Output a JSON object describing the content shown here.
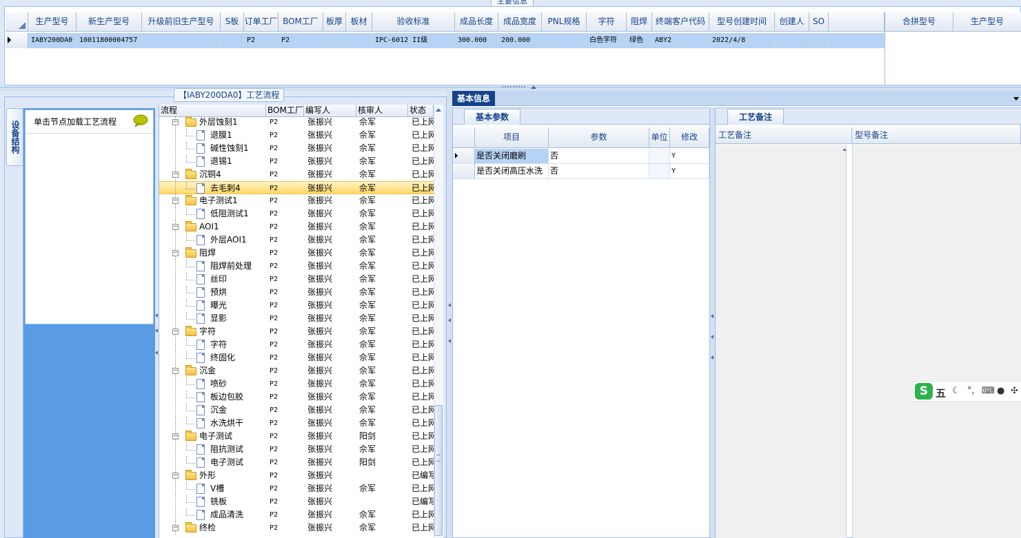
{
  "top": {
    "title": "主要信息",
    "columns": [
      "生产型号",
      "新生产型号",
      "升级前旧生产型号",
      "S板",
      "订单工厂",
      "BOM工厂",
      "板厚",
      "板材",
      "验收标准",
      "成品长度",
      "成品宽度",
      "PNL规格",
      "字符",
      "阻焊",
      "终端客户代码",
      "型号创建时间",
      "创建人",
      "SO"
    ],
    "row": [
      "IABY200DA0",
      "10011800004757",
      "",
      "",
      "P2",
      "P2",
      "",
      "",
      "IPC-6012 II级",
      "300.000",
      "200.000",
      "",
      "白色字符",
      "绿色",
      "ABY2",
      "2022/4/8",
      "",
      ""
    ],
    "merge_columns": [
      "合拼型号",
      "生产型号"
    ]
  },
  "process": {
    "title": "【IABY200DA0】工艺流程",
    "side_tab": "设备结构",
    "hint": "单击节点加载工艺流程",
    "columns": [
      "流程",
      "BOM工厂",
      "编写人",
      "核审人",
      "状态"
    ],
    "rows": [
      {
        "name": "外层蚀刻1",
        "type": "folder",
        "bom": "P2",
        "writer": "张振兴",
        "reviewer": "佘军",
        "status": "已上网"
      },
      {
        "name": "退膜1",
        "type": "leaf",
        "bom": "P2",
        "writer": "张振兴",
        "reviewer": "佘军",
        "status": "已上网"
      },
      {
        "name": "碱性蚀刻1",
        "type": "leaf",
        "bom": "P2",
        "writer": "张振兴",
        "reviewer": "佘军",
        "status": "已上网"
      },
      {
        "name": "退锡1",
        "type": "leaf",
        "bom": "P2",
        "writer": "张振兴",
        "reviewer": "佘军",
        "status": "已上网"
      },
      {
        "name": "沉铜4",
        "type": "folder",
        "bom": "P2",
        "writer": "张振兴",
        "reviewer": "佘军",
        "status": "已上网"
      },
      {
        "name": "去毛刺4",
        "type": "leaf",
        "bom": "P2",
        "writer": "张振兴",
        "reviewer": "佘军",
        "status": "已上网",
        "selected": true
      },
      {
        "name": "电子测试1",
        "type": "folder",
        "bom": "P2",
        "writer": "张振兴",
        "reviewer": "佘军",
        "status": "已上网"
      },
      {
        "name": "低阻测试1",
        "type": "leaf",
        "bom": "P2",
        "writer": "张振兴",
        "reviewer": "佘军",
        "status": "已上网"
      },
      {
        "name": "AOI1",
        "type": "folder",
        "bom": "P2",
        "writer": "张振兴",
        "reviewer": "佘军",
        "status": "已上网"
      },
      {
        "name": "外层AOI1",
        "type": "leaf",
        "bom": "P2",
        "writer": "张振兴",
        "reviewer": "佘军",
        "status": "已上网"
      },
      {
        "name": "阻焊",
        "type": "folder",
        "bom": "P2",
        "writer": "张振兴",
        "reviewer": "佘军",
        "status": "已上网"
      },
      {
        "name": "阻焊前处理",
        "type": "leaf",
        "bom": "P2",
        "writer": "张振兴",
        "reviewer": "佘军",
        "status": "已上网"
      },
      {
        "name": "丝印",
        "type": "leaf",
        "bom": "P2",
        "writer": "张振兴",
        "reviewer": "佘军",
        "status": "已上网"
      },
      {
        "name": "预烘",
        "type": "leaf",
        "bom": "P2",
        "writer": "张振兴",
        "reviewer": "佘军",
        "status": "已上网"
      },
      {
        "name": "曝光",
        "type": "leaf",
        "bom": "P2",
        "writer": "张振兴",
        "reviewer": "佘军",
        "status": "已上网"
      },
      {
        "name": "显影",
        "type": "leaf",
        "bom": "P2",
        "writer": "张振兴",
        "reviewer": "佘军",
        "status": "已上网"
      },
      {
        "name": "字符",
        "type": "folder",
        "bom": "P2",
        "writer": "张振兴",
        "reviewer": "佘军",
        "status": "已上网"
      },
      {
        "name": "字符",
        "type": "leaf",
        "bom": "P2",
        "writer": "张振兴",
        "reviewer": "佘军",
        "status": "已上网"
      },
      {
        "name": "终固化",
        "type": "leaf",
        "bom": "P2",
        "writer": "张振兴",
        "reviewer": "佘军",
        "status": "已上网"
      },
      {
        "name": "沉金",
        "type": "folder",
        "bom": "P2",
        "writer": "张振兴",
        "reviewer": "佘军",
        "status": "已上网"
      },
      {
        "name": "喷砂",
        "type": "leaf",
        "bom": "P2",
        "writer": "张振兴",
        "reviewer": "佘军",
        "status": "已上网"
      },
      {
        "name": "板边包胶",
        "type": "leaf",
        "bom": "P2",
        "writer": "张振兴",
        "reviewer": "佘军",
        "status": "已上网"
      },
      {
        "name": "沉金",
        "type": "leaf",
        "bom": "P2",
        "writer": "张振兴",
        "reviewer": "佘军",
        "status": "已上网"
      },
      {
        "name": "水洗烘干",
        "type": "leaf",
        "bom": "P2",
        "writer": "张振兴",
        "reviewer": "佘军",
        "status": "已上网"
      },
      {
        "name": "电子测试",
        "type": "folder",
        "bom": "P2",
        "writer": "张振兴",
        "reviewer": "阳剑",
        "status": "已上网"
      },
      {
        "name": "阻抗测试",
        "type": "leaf",
        "bom": "P2",
        "writer": "张振兴",
        "reviewer": "佘军",
        "status": "已上网"
      },
      {
        "name": "电子测试",
        "type": "leaf",
        "bom": "P2",
        "writer": "张振兴",
        "reviewer": "阳剑",
        "status": "已上网"
      },
      {
        "name": "外形",
        "type": "folder",
        "bom": "P2",
        "writer": "张振兴",
        "reviewer": "",
        "status": "已编写"
      },
      {
        "name": "V槽",
        "type": "leaf",
        "bom": "P2",
        "writer": "张振兴",
        "reviewer": "佘军",
        "status": "已上网"
      },
      {
        "name": "铣板",
        "type": "leaf",
        "bom": "P2",
        "writer": "张振兴",
        "reviewer": "",
        "status": "已编写"
      },
      {
        "name": "成品清洗",
        "type": "leaf",
        "bom": "P2",
        "writer": "张振兴",
        "reviewer": "佘军",
        "status": "已上网"
      },
      {
        "name": "终检",
        "type": "folder",
        "bom": "P2",
        "writer": "张振兴",
        "reviewer": "佘军",
        "status": "已上网"
      }
    ]
  },
  "basic": {
    "tab": "基本信息",
    "params_tab": "基本参数",
    "param_columns": [
      "项目",
      "参数",
      "单位",
      "修改"
    ],
    "params": [
      {
        "item": "是否关闭磨刷",
        "value": "否",
        "unit": "",
        "modify": "Y"
      },
      {
        "item": "是否关闭高压水洗",
        "value": "否",
        "unit": "",
        "modify": "Y"
      }
    ],
    "notes_tab": "工艺备注",
    "note_columns": [
      "工艺备注",
      "型号备注"
    ]
  },
  "ime": {
    "logo": "S",
    "mode": "五"
  },
  "colors": {
    "accent": "#15428b",
    "selection": "#b6d2f4",
    "side": "#5a9be6"
  }
}
